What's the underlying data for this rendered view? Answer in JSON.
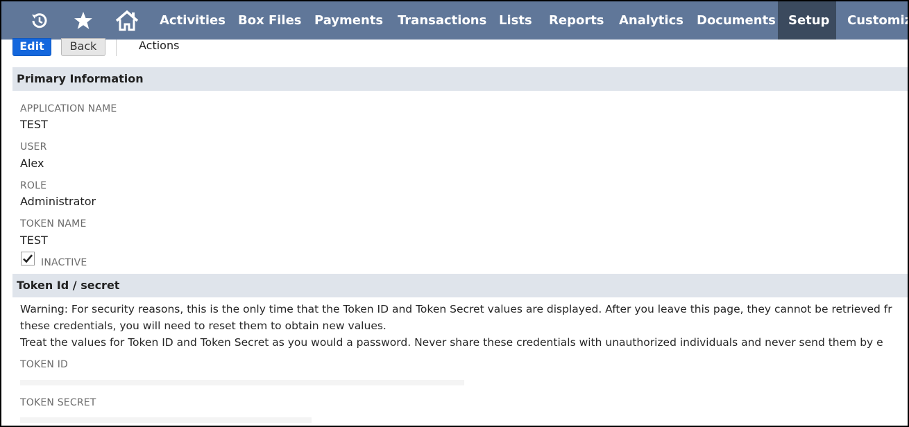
{
  "nav": {
    "icons": [
      "recent-icon",
      "star-icon",
      "home-icon"
    ],
    "items": [
      {
        "label": "Activities"
      },
      {
        "label": "Box Files"
      },
      {
        "label": "Payments"
      },
      {
        "label": "Transactions"
      },
      {
        "label": "Lists"
      },
      {
        "label": "Reports"
      },
      {
        "label": "Analytics"
      },
      {
        "label": "Documents"
      },
      {
        "label": "Setup",
        "active": true
      },
      {
        "label": "Customiza"
      }
    ]
  },
  "toolbar": {
    "edit_label": "Edit",
    "back_label": "Back",
    "actions_label": "Actions"
  },
  "primary": {
    "title": "Primary Information",
    "application_name_label": "APPLICATION NAME",
    "application_name_value": "TEST",
    "user_label": "USER",
    "user_value": "Alex",
    "role_label": "ROLE",
    "role_value": "Administrator",
    "token_name_label": "TOKEN NAME",
    "token_name_value": "TEST",
    "inactive_label": "INACTIVE",
    "inactive_checked": true
  },
  "token": {
    "title": "Token Id / secret",
    "warning_line1": "Warning: For security reasons, this is the only time that the Token ID and Token Secret values are displayed. After you leave this page, they cannot be retrieved fr",
    "warning_line2": "these credentials, you will need to reset them to obtain new values.",
    "warning_line3": "Treat the values for Token ID and Token Secret as you would a password. Never share these credentials with unauthorized individuals and never send them by e",
    "token_id_label": "TOKEN ID",
    "token_secret_label": "TOKEN SECRET"
  },
  "colors": {
    "nav_bg": "#607799",
    "nav_active": "#3b4a5e",
    "edit_button": "#1467dd",
    "section_bg": "#dfe4eb"
  }
}
